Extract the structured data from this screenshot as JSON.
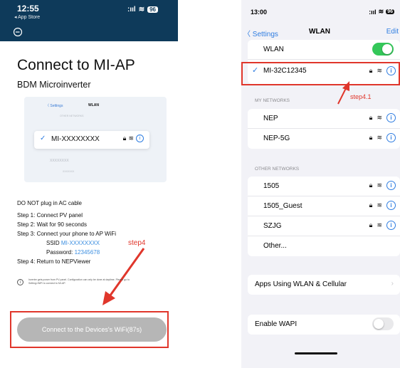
{
  "left": {
    "status": {
      "time": "12:55",
      "back_label": "◂ App Store",
      "signal": ":ııl",
      "wifi": "≋",
      "battery": "96"
    },
    "title": "Connect to MI-AP",
    "subtitle": "BDM Microinverter",
    "mock": {
      "back": "〈 Settings",
      "title": "WLAN",
      "section": "OTHER NETWORKS",
      "network": "MI-XXXXXXXX",
      "check": "✓",
      "blur1": "XXXXXXXX",
      "blur2": "XXXXXXX"
    },
    "warning": "DO NOT plug in AC cable",
    "steps": {
      "s1": "Step 1: Connect PV panel",
      "s2": "Step 2: Wait for 90 seconds",
      "s3": "Step 3: Connect your phone to AP WiFi",
      "ssid_label": "SSID",
      "ssid_value": "MI-XXXXXXXX",
      "pwd_label": "Password:",
      "pwd_value": "12345678",
      "s4": "Step 4: Return to NEPViewer"
    },
    "note": "Inverter gets power from PV panel.  Configuration can only be done at daytime. Please go to Setting>WiFi to connect to MI-AP.",
    "cta": "Connect to the Devices's WiFi(87s)",
    "annotation": "step4"
  },
  "right": {
    "status": {
      "time": "13:00",
      "signal": ":ııl",
      "wifi": "≋",
      "battery": "96"
    },
    "nav": {
      "back": "〈 Settings",
      "title": "WLAN",
      "edit": "Edit"
    },
    "wlan_label": "WLAN",
    "wlan_on": true,
    "connected": "MI-32C12345",
    "my_networks_header": "MY NETWORKS",
    "my_networks": [
      "NEP",
      "NEP-5G"
    ],
    "other_networks_header": "OTHER NETWORKS",
    "other_networks": [
      "1505",
      "1505_Guest",
      "SZJG"
    ],
    "other_label": "Other...",
    "apps_label": "Apps Using WLAN & Cellular",
    "wapi_label": "Enable WAPI",
    "wapi_on": false,
    "annotation": "step4.1"
  },
  "colors": {
    "accent": "#2f7de1",
    "header": "#0e3a5a",
    "annotation": "#e0362b",
    "toggle_on": "#34c759"
  }
}
